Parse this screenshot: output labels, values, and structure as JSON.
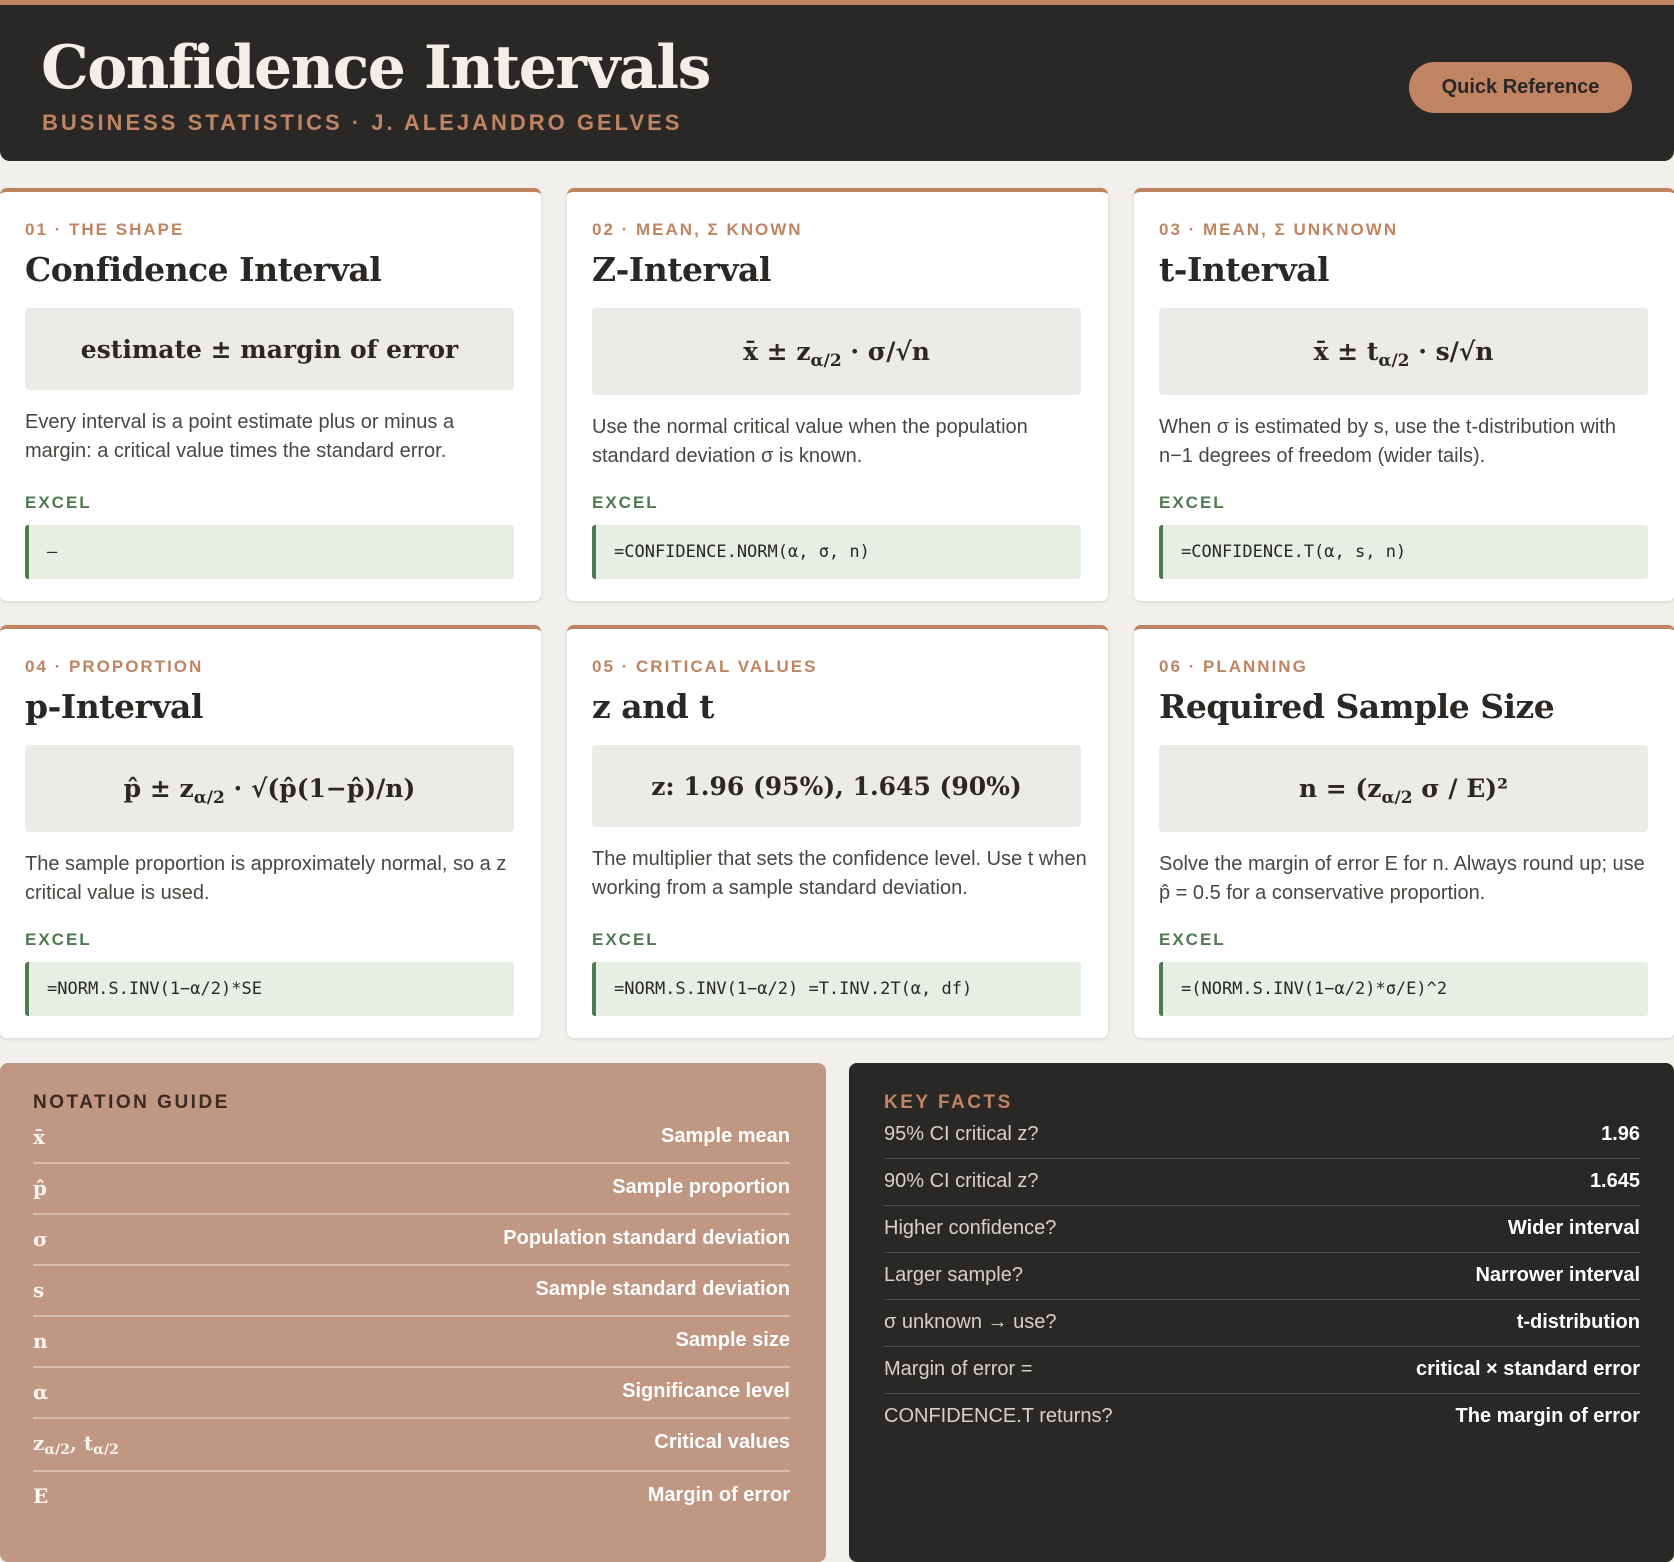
{
  "header": {
    "title": "Confidence Intervals",
    "subtitle": "BUSINESS STATISTICS · J. ALEJANDRO GELVES",
    "quick_reference_label": "Quick Reference"
  },
  "cards": [
    {
      "kicker": "01 · THE SHAPE",
      "title": "Confidence Interval",
      "formula": {
        "pre": "estimate ± margin of error",
        "sub": "",
        "post": ""
      },
      "description": "Every interval is a point estimate plus or minus a margin: a critical value times the standard error.",
      "excel_label": "EXCEL",
      "excel_code": "—"
    },
    {
      "kicker": "02 · MEAN, Σ KNOWN",
      "title": "Z-Interval",
      "formula": {
        "pre": "x̄ ± z",
        "sub": "α/2",
        "post": " · σ/√n"
      },
      "description": "Use the normal critical value when the population standard deviation σ is known.",
      "excel_label": "EXCEL",
      "excel_code": "=CONFIDENCE.NORM(α, σ, n)"
    },
    {
      "kicker": "03 · MEAN, Σ UNKNOWN",
      "title": "t-Interval",
      "formula": {
        "pre": "x̄ ± t",
        "sub": "α/2",
        "post": " · s/√n"
      },
      "description": "When σ is estimated by s, use the t-distribution with n−1 degrees of freedom (wider tails).",
      "excel_label": "EXCEL",
      "excel_code": "=CONFIDENCE.T(α, s, n)"
    },
    {
      "kicker": "04 · PROPORTION",
      "title": "p-Interval",
      "formula": {
        "pre": "p̂ ± z",
        "sub": "α/2",
        "post": " · √(p̂(1−p̂)/n)"
      },
      "description": "The sample proportion is approximately normal, so a z critical value is used.",
      "excel_label": "EXCEL",
      "excel_code": "=NORM.S.INV(1−α/2)*SE"
    },
    {
      "kicker": "05 · CRITICAL VALUES",
      "title": "z and t",
      "formula": {
        "pre": "z: 1.96 (95%), 1.645 (90%)",
        "sub": "",
        "post": ""
      },
      "description": "The multiplier that sets the confidence level. Use t when working from a sample standard deviation.",
      "excel_label": "EXCEL",
      "excel_code": "=NORM.S.INV(1−α/2) =T.INV.2T(α, df)"
    },
    {
      "kicker": "06 · PLANNING",
      "title": "Required Sample Size",
      "formula": {
        "pre": "n = (z",
        "sub": "α/2",
        "post": " σ / E)²"
      },
      "description": "Solve the margin of error E for n. Always round up; use p̂ = 0.5 for a conservative proportion.",
      "excel_label": "EXCEL",
      "excel_code": "=(NORM.S.INV(1−α/2)*σ/E)^2"
    }
  ],
  "notation": {
    "title": "NOTATION GUIDE",
    "rows": [
      {
        "symbol": "x̄",
        "meaning": "Sample mean"
      },
      {
        "symbol": "p̂",
        "meaning": "Sample proportion"
      },
      {
        "symbol": "σ",
        "meaning": "Population standard deviation"
      },
      {
        "symbol": "s",
        "meaning": "Sample standard deviation"
      },
      {
        "symbol": "n",
        "meaning": "Sample size"
      },
      {
        "symbol": "α",
        "meaning": "Significance level"
      },
      {
        "symbol_a": "z",
        "symbol_a_sub": "α/2",
        "symbol_sep": ", t",
        "symbol_b_sub": "α/2",
        "meaning": "Critical values"
      },
      {
        "symbol": "E",
        "meaning": "Margin of error"
      }
    ]
  },
  "key_facts": {
    "title": "KEY FACTS",
    "rows": [
      {
        "question": "95% CI critical z?",
        "answer": "1.96"
      },
      {
        "question": "90% CI critical z?",
        "answer": "1.645"
      },
      {
        "question": "Higher confidence?",
        "answer": "Wider interval"
      },
      {
        "question": "Larger sample?",
        "answer": "Narrower interval"
      },
      {
        "question": "σ unknown → use?",
        "answer": "t-distribution"
      },
      {
        "question": "Margin of error =",
        "answer": "critical × standard error"
      },
      {
        "question": "CONFIDENCE.T returns?",
        "answer": "The margin of error"
      }
    ]
  }
}
